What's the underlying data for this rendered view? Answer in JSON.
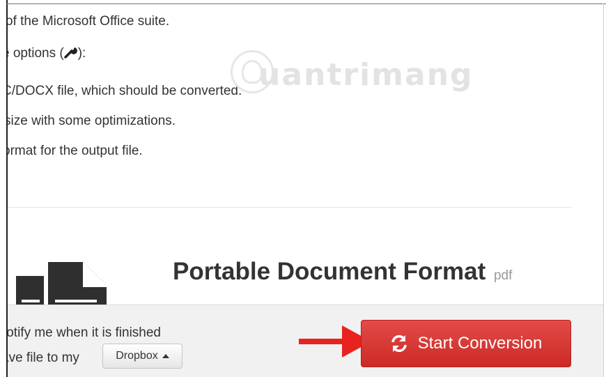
{
  "content": {
    "lines": [
      "of the Microsoft Office suite.",
      "e options (",
      "C/DOCX file, which should be converted.",
      "size with some optimizations.",
      "ormat for the output file."
    ],
    "options_suffix": "):",
    "options_icon": "wrench-icon"
  },
  "watermark": {
    "text": "uantrimang",
    "icon": "lightbulb-icon"
  },
  "format": {
    "title": "Portable Document Format",
    "extension": "pdf",
    "icon": "document-icon"
  },
  "footer": {
    "notify_label": "lotify me when it is finished",
    "save_label": "ave file to my",
    "dropbox_label": "Dropbox",
    "dropbox_icon": "caret-up-icon",
    "start_label": "Start Conversion",
    "start_icon": "refresh-icon"
  },
  "colors": {
    "primary_button": "#d9363e",
    "arrow": "#e8231f",
    "footer_bg": "#f1f1f1"
  }
}
